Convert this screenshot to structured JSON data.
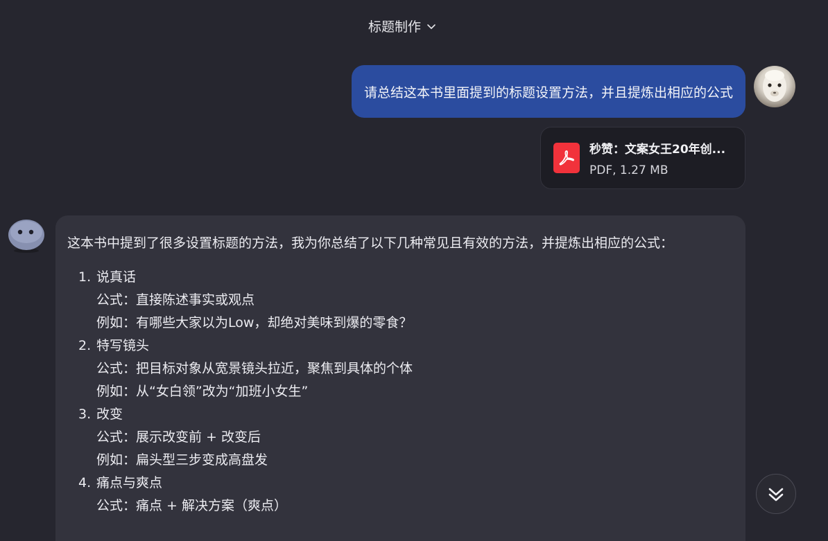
{
  "header": {
    "title": "标题制作"
  },
  "user_message": {
    "text": "请总结这本书里面提到的标题设置方法，并且提炼出相应的公式"
  },
  "attachment": {
    "name": "秒赞：文案女王20年创...",
    "meta": "PDF, 1.27 MB",
    "icon": "pdf-icon",
    "color": "#f1323b"
  },
  "bot_message": {
    "intro": "这本书中提到了很多设置标题的方法，我为你总结了以下几种常见且有效的方法，并提炼出相应的公式：",
    "items": [
      {
        "num": "1.",
        "title": "说真话",
        "formula": "公式：直接陈述事实或观点",
        "example": "例如：有哪些大家以为Low，却绝对美味到爆的零食？"
      },
      {
        "num": "2.",
        "title": "特写镜头",
        "formula": "公式：把目标对象从宽景镜头拉近，聚焦到具体的个体",
        "example": "例如：从“女白领”改为“加班小女生”"
      },
      {
        "num": "3.",
        "title": "改变",
        "formula": "公式：展示改变前 + 改变后",
        "example": "例如：扁头型三步变成高盘发"
      },
      {
        "num": "4.",
        "title": "痛点与爽点",
        "formula": "公式：痛点 + 解决方案（爽点）",
        "example": ""
      }
    ]
  },
  "colors": {
    "background": "#26262f",
    "user_bubble": "#2b4c9f",
    "bot_bubble": "#33333d",
    "file_card": "#1d1d24"
  }
}
